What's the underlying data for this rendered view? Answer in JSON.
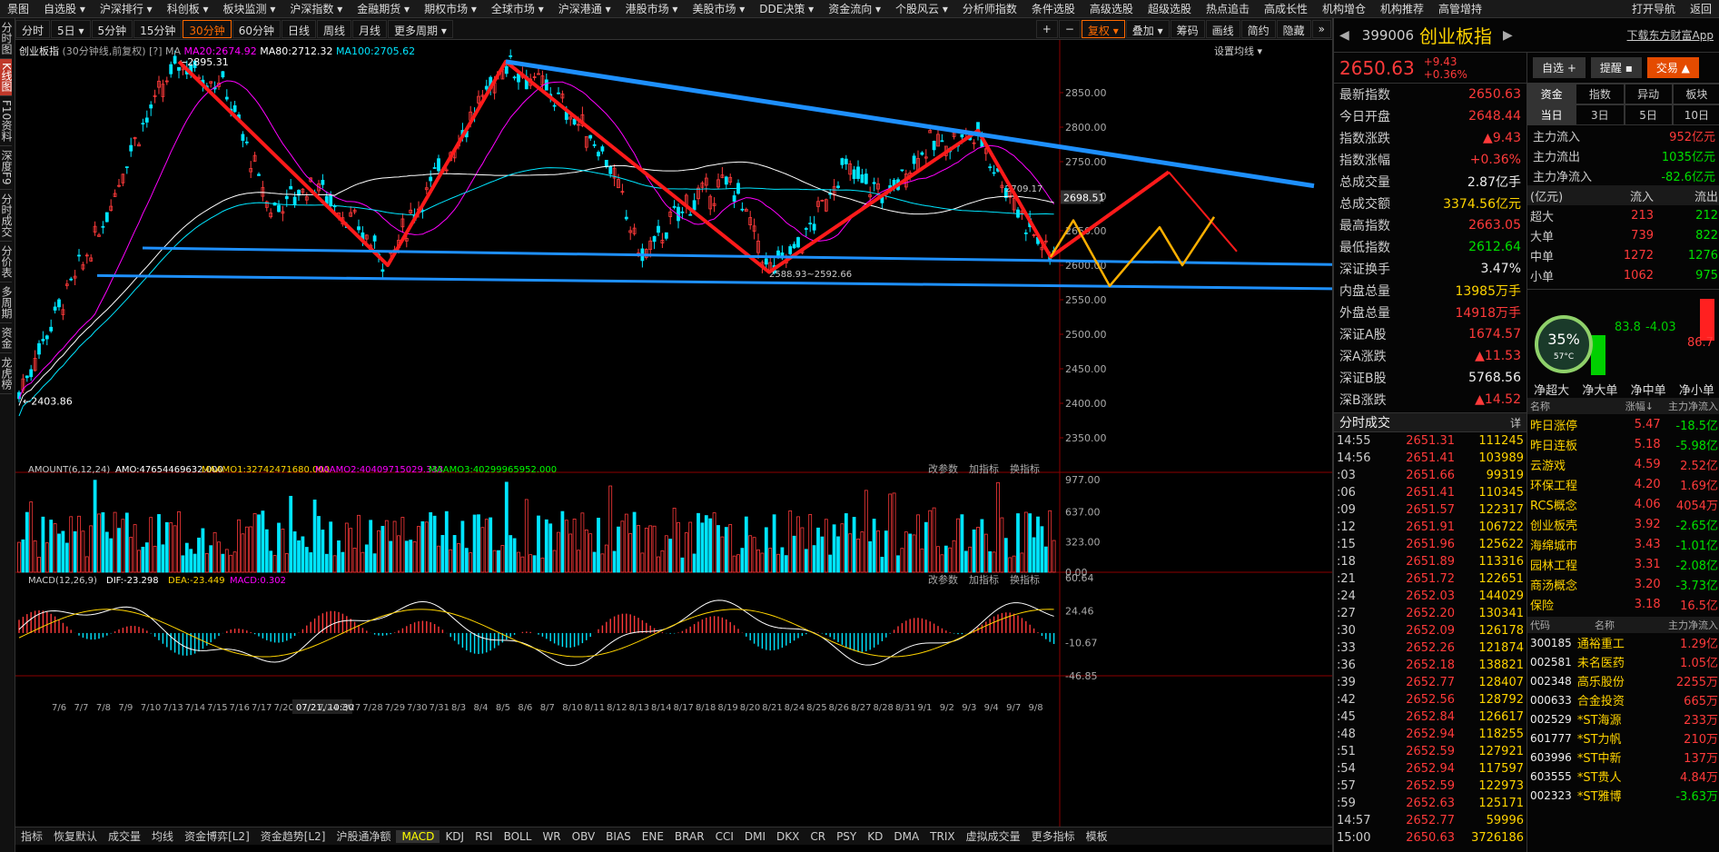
{
  "menu": {
    "items": [
      "自选股 ▾",
      "沪深排行 ▾",
      "科创板 ▾",
      "板块监测 ▾",
      "沪深指数 ▾",
      "金融期货 ▾",
      "期权市场 ▾",
      "全球市场 ▾",
      "沪深港通 ▾",
      "港股市场 ▾",
      "美股市场 ▾",
      "DDE决策 ▾",
      "资金流向 ▾",
      "个股风云 ▾",
      "分析师指数",
      "条件选股",
      "高级选股",
      "超级选股",
      "热点追击",
      "高成长性",
      "机构增仓",
      "机构推荐",
      "高管增持"
    ],
    "right": [
      "打开导航",
      "返回"
    ]
  },
  "leftstrip": [
    "分时图",
    "K线图",
    "F10资料",
    "深度F9",
    "分时成交",
    "分价表",
    "多周期",
    "资金",
    "龙虎榜"
  ],
  "toolbar": {
    "periods": [
      "分时",
      "5日 ▾",
      "5分钟",
      "15分钟",
      "30分钟",
      "60分钟",
      "日线",
      "周线",
      "月线",
      "更多周期 ▾"
    ],
    "active": "30分钟",
    "right": [
      "+",
      "−",
      "复权 ▾",
      "叠加 ▾",
      "筹码",
      "画线",
      "简约",
      "隐藏",
      "»"
    ]
  },
  "chart": {
    "legend_name": "创业板指",
    "legend_sub": "(30分钟线,前复权)",
    "ma20": "MA20:2674.92",
    "ma80": "MA80:2712.32",
    "ma100": "MA100:2705.62",
    "setting": "设置均线 ▾",
    "price_ticks": [
      "2850.00",
      "2800.00",
      "2750.00",
      "2700.00",
      "2650.00",
      "2600.00",
      "2550.00",
      "2500.00",
      "2450.00",
      "2400.00",
      "2350.00"
    ],
    "high_label": "2895.31",
    "low_label": "2403.86",
    "box_label": "2588.93~2592.66",
    "right_price": "2698.51",
    "right_label2": "2709.17",
    "amount_legend": "AMOUNT(6,12,24)",
    "amo": "AMO:47654469632.000",
    "maamo1": "MAAMO1:32742471680.000",
    "maamo2": "MAAMO2:40409715029.333",
    "maamo3": "MAAMO3:40299965952.000",
    "amount_ticks": [
      "977.00",
      "637.00",
      "323.00",
      "0.00"
    ],
    "macd_legend": "MACD(12,26,9)",
    "dif": "DIF:-23.298",
    "dea": "DEA:-23.449",
    "macd": "MACD:0.302",
    "macd_ticks": [
      "60.64",
      "24.46",
      "-10.67",
      "-46.85"
    ],
    "panel_ops": [
      "改参数",
      "加指标",
      "换指标"
    ],
    "dates": [
      "7/6",
      "7/7",
      "7/8",
      "7/9",
      "7/10",
      "7/13",
      "7/14",
      "7/15",
      "7/16",
      "7/17",
      "7/20",
      "07/21, 10:30",
      "7/24",
      "7/27",
      "7/28",
      "7/29",
      "7/30",
      "7/31",
      "8/3",
      "8/4",
      "8/5",
      "8/6",
      "8/7",
      "8/10",
      "8/11",
      "8/12",
      "8/13",
      "8/14",
      "8/17",
      "8/18",
      "8/19",
      "8/20",
      "8/21",
      "8/24",
      "8/25",
      "8/26",
      "8/27",
      "8/28",
      "8/31",
      "9/1",
      "9/2",
      "9/3",
      "9/4",
      "9/7",
      "9/8"
    ]
  },
  "bottom": {
    "tabs": [
      "指标",
      "恢复默认",
      "成交量",
      "均线",
      "资金博弈[L2]",
      "资金趋势[L2]",
      "沪股通净额",
      "MACD",
      "KDJ",
      "RSI",
      "BOLL",
      "WR",
      "OBV",
      "BIAS",
      "ENE",
      "BRAR",
      "CCI",
      "DMI",
      "DKX",
      "CR",
      "PSY",
      "KD",
      "DMA",
      "TRIX",
      "虚拟成交量",
      "更多指标",
      "模板"
    ],
    "active": "MACD"
  },
  "quote": {
    "code": "399006",
    "name": "创业板指",
    "price": "2650.63",
    "change": "+9.43",
    "pct": "+0.36%",
    "app": "下载东方财富App",
    "btn_watch": "自选 +",
    "btn_remind": "提醒 ▪",
    "btn_trade": "交易 ▲",
    "rows": [
      [
        "最新指数",
        "2650.63",
        "red"
      ],
      [
        "今日开盘",
        "2648.44",
        "red"
      ],
      [
        "指数涨跌",
        "▲9.43",
        "red"
      ],
      [
        "指数涨幅",
        "+0.36%",
        "red"
      ],
      [
        "总成交量",
        "2.87亿手",
        "wht"
      ],
      [
        "总成交额",
        "3374.56亿元",
        "yel"
      ],
      [
        "最高指数",
        "2663.05",
        "red"
      ],
      [
        "最低指数",
        "2612.64",
        "grn"
      ],
      [
        "深证换手",
        "3.47%",
        "wht"
      ],
      [
        "内盘总量",
        "13985万手",
        "yel"
      ],
      [
        "外盘总量",
        "14918万手",
        "red"
      ],
      [
        "深证A股",
        "1674.57",
        "red"
      ],
      [
        "深A涨跌",
        "▲11.53",
        "red"
      ],
      [
        "深证B股",
        "5768.56",
        "wht"
      ],
      [
        "深B涨跌",
        "▲14.52",
        "red"
      ]
    ],
    "ticks_title": "分时成交",
    "ticks_more": "详",
    "ticks": [
      [
        "14:55",
        "2651.31",
        "111245"
      ],
      [
        "14:56",
        "2651.41",
        "103989"
      ],
      [
        ":03",
        "2651.66",
        "99319"
      ],
      [
        ":06",
        "2651.41",
        "110345"
      ],
      [
        ":09",
        "2651.57",
        "122317"
      ],
      [
        ":12",
        "2651.91",
        "106722"
      ],
      [
        ":15",
        "2651.96",
        "125622"
      ],
      [
        ":18",
        "2651.89",
        "113316"
      ],
      [
        ":21",
        "2651.72",
        "122651"
      ],
      [
        ":24",
        "2652.03",
        "144029"
      ],
      [
        ":27",
        "2652.20",
        "130341"
      ],
      [
        ":30",
        "2652.09",
        "126178"
      ],
      [
        ":33",
        "2652.26",
        "121874"
      ],
      [
        ":36",
        "2652.18",
        "138821"
      ],
      [
        ":39",
        "2652.77",
        "128407"
      ],
      [
        ":42",
        "2652.56",
        "128792"
      ],
      [
        ":45",
        "2652.84",
        "126617"
      ],
      [
        ":48",
        "2652.94",
        "118255"
      ],
      [
        ":51",
        "2652.59",
        "127921"
      ],
      [
        ":54",
        "2652.94",
        "117597"
      ],
      [
        ":57",
        "2652.59",
        "122973"
      ],
      [
        ":59",
        "2652.63",
        "125171"
      ],
      [
        "14:57",
        "2652.77",
        "59996"
      ],
      [
        "15:00",
        "2650.63",
        "3726186"
      ]
    ]
  },
  "flow": {
    "tabs1": [
      "资金",
      "指数",
      "异动",
      "板块"
    ],
    "tabs2": [
      "当日",
      "3日",
      "5日",
      "10日"
    ],
    "main": [
      [
        "主力流入",
        "952亿元",
        "red"
      ],
      [
        "主力流出",
        "1035亿元",
        "grn"
      ],
      [
        "主力净流入",
        "-82.6亿元",
        "grn"
      ]
    ],
    "hdr": [
      "(亿元)",
      "流入",
      "流出"
    ],
    "sizes": [
      [
        "超大",
        "213",
        "212"
      ],
      [
        "大单",
        "739",
        "822"
      ],
      [
        "中单",
        "1272",
        "1276"
      ],
      [
        "小单",
        "1062",
        "975"
      ]
    ],
    "gauge": "35%",
    "temp": "57°C",
    "v1": "83.8",
    "v2": "-4.03",
    "v3": "86.7",
    "net_labels": [
      "净超大",
      "净大单",
      "净中单",
      "净小单"
    ],
    "sector_hdr": [
      "名称",
      "涨幅↓",
      "主力净流入"
    ],
    "sectors": [
      [
        "昨日涨停",
        "5.47",
        "-18.5亿"
      ],
      [
        "昨日连板",
        "5.18",
        "-5.98亿"
      ],
      [
        "云游戏",
        "4.59",
        "2.52亿"
      ],
      [
        "环保工程",
        "4.20",
        "1.69亿"
      ],
      [
        "RCS概念",
        "4.06",
        "4054万"
      ],
      [
        "创业板壳",
        "3.92",
        "-2.65亿"
      ],
      [
        "海绵城市",
        "3.43",
        "-1.01亿"
      ],
      [
        "园林工程",
        "3.31",
        "-2.08亿"
      ],
      [
        "商汤概念",
        "3.20",
        "-3.73亿"
      ],
      [
        "保险",
        "3.18",
        "16.5亿"
      ]
    ],
    "stock_hdr": [
      "代码",
      "名称",
      "主力净流入"
    ],
    "stocks": [
      [
        "300185",
        "通裕重工",
        "1.29亿"
      ],
      [
        "002581",
        "未名医药",
        "1.05亿"
      ],
      [
        "002348",
        "高乐股份",
        "2255万"
      ],
      [
        "000633",
        "合金投资",
        "665万"
      ],
      [
        "002529",
        "*ST海源",
        "233万"
      ],
      [
        "601777",
        "*ST力帆",
        "210万"
      ],
      [
        "603996",
        "*ST中新",
        "137万"
      ],
      [
        "603555",
        "*ST贵人",
        "4.84万"
      ],
      [
        "002323",
        "*ST雅博",
        "-3.63万"
      ]
    ]
  },
  "colors": {
    "up": "#ff3a3a",
    "down": "#00e5ff",
    "ma20": "#ff00ff",
    "ma80": "#ffffff",
    "ma100": "#00e5ff",
    "trend_red": "#ff1a1a",
    "trend_blue": "#1e90ff",
    "trend_orange": "#ffb000"
  }
}
